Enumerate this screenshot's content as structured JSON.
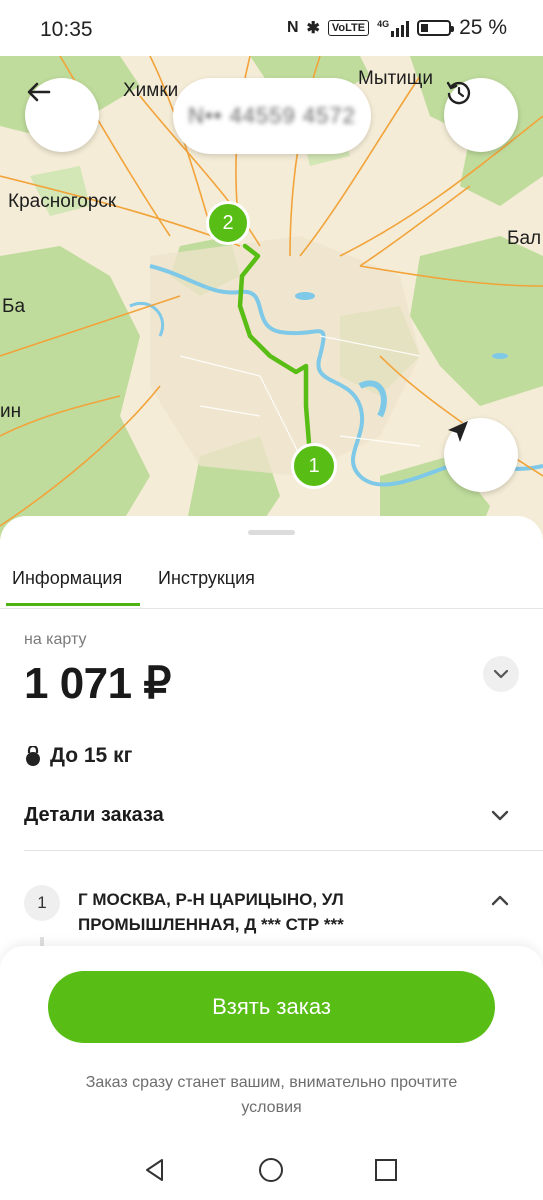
{
  "status_bar": {
    "time": "10:35",
    "battery_text": "25 %",
    "battery_level": 0.25,
    "nfc": "N",
    "bluetooth": "✱",
    "volte": "VoLTE",
    "network": "4G"
  },
  "map": {
    "labels": [
      "Химки",
      "Мытищи",
      "Красногорск",
      "Бал",
      "Ба",
      "ин"
    ],
    "markers": [
      "1",
      "2"
    ],
    "route_color": "#58bd14"
  },
  "header": {
    "order_number": "N•• 44559 4572"
  },
  "tabs": [
    {
      "label": "Информация",
      "active": true
    },
    {
      "label": "Инструкция",
      "active": false
    }
  ],
  "payment": {
    "label": "на карту",
    "price": "1 071 ₽"
  },
  "weight": {
    "icon": "kettlebell-icon",
    "label": "До 15 кг"
  },
  "details": {
    "label": "Детали заказа"
  },
  "route_points": [
    {
      "number": "1",
      "address": "Г МОСКВА, Р-Н ЦАРИЦЫНО, УЛ ПРОМЫШЛЕННАЯ, Д *** СТР ***"
    }
  ],
  "action": {
    "button_label": "Взять заказ",
    "hint": "Заказ сразу станет вашим, внимательно прочтите условия"
  },
  "colors": {
    "accent": "#58bd14",
    "map_base": "#f4ecd6",
    "forest": "#bfdc9c",
    "water": "#7ec8e8",
    "roads": "#f2a33a"
  }
}
